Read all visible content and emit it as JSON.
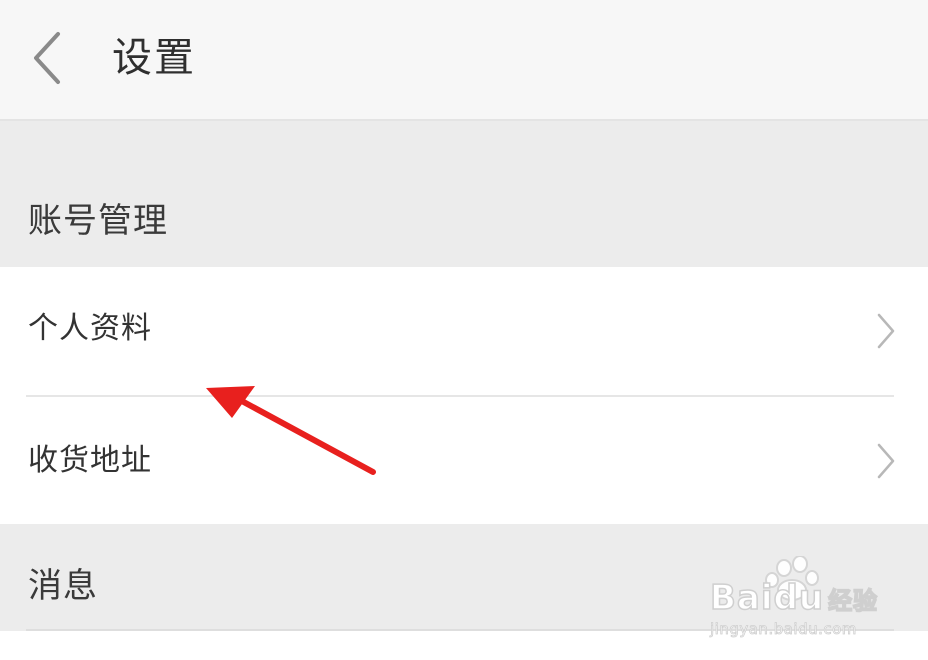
{
  "header": {
    "title": "设置",
    "back_icon": "chevron-left-icon"
  },
  "sections": [
    {
      "title": "账号管理",
      "items": [
        {
          "label": "个人资料",
          "icon": "chevron-right-icon"
        },
        {
          "label": "收货地址",
          "icon": "chevron-right-icon"
        }
      ]
    },
    {
      "title": "消息",
      "items": []
    }
  ],
  "annotation": {
    "arrow_color": "#e8201e",
    "points_to": "个人资料"
  },
  "watermark": {
    "brand": "Baidu",
    "suffix": "经验",
    "url": "jingyan.baidu.com"
  },
  "colors": {
    "background": "#ececec",
    "header_bg": "#f7f7f7",
    "list_bg": "#ffffff",
    "text": "#333333",
    "chevron": "#b8b8b8"
  }
}
